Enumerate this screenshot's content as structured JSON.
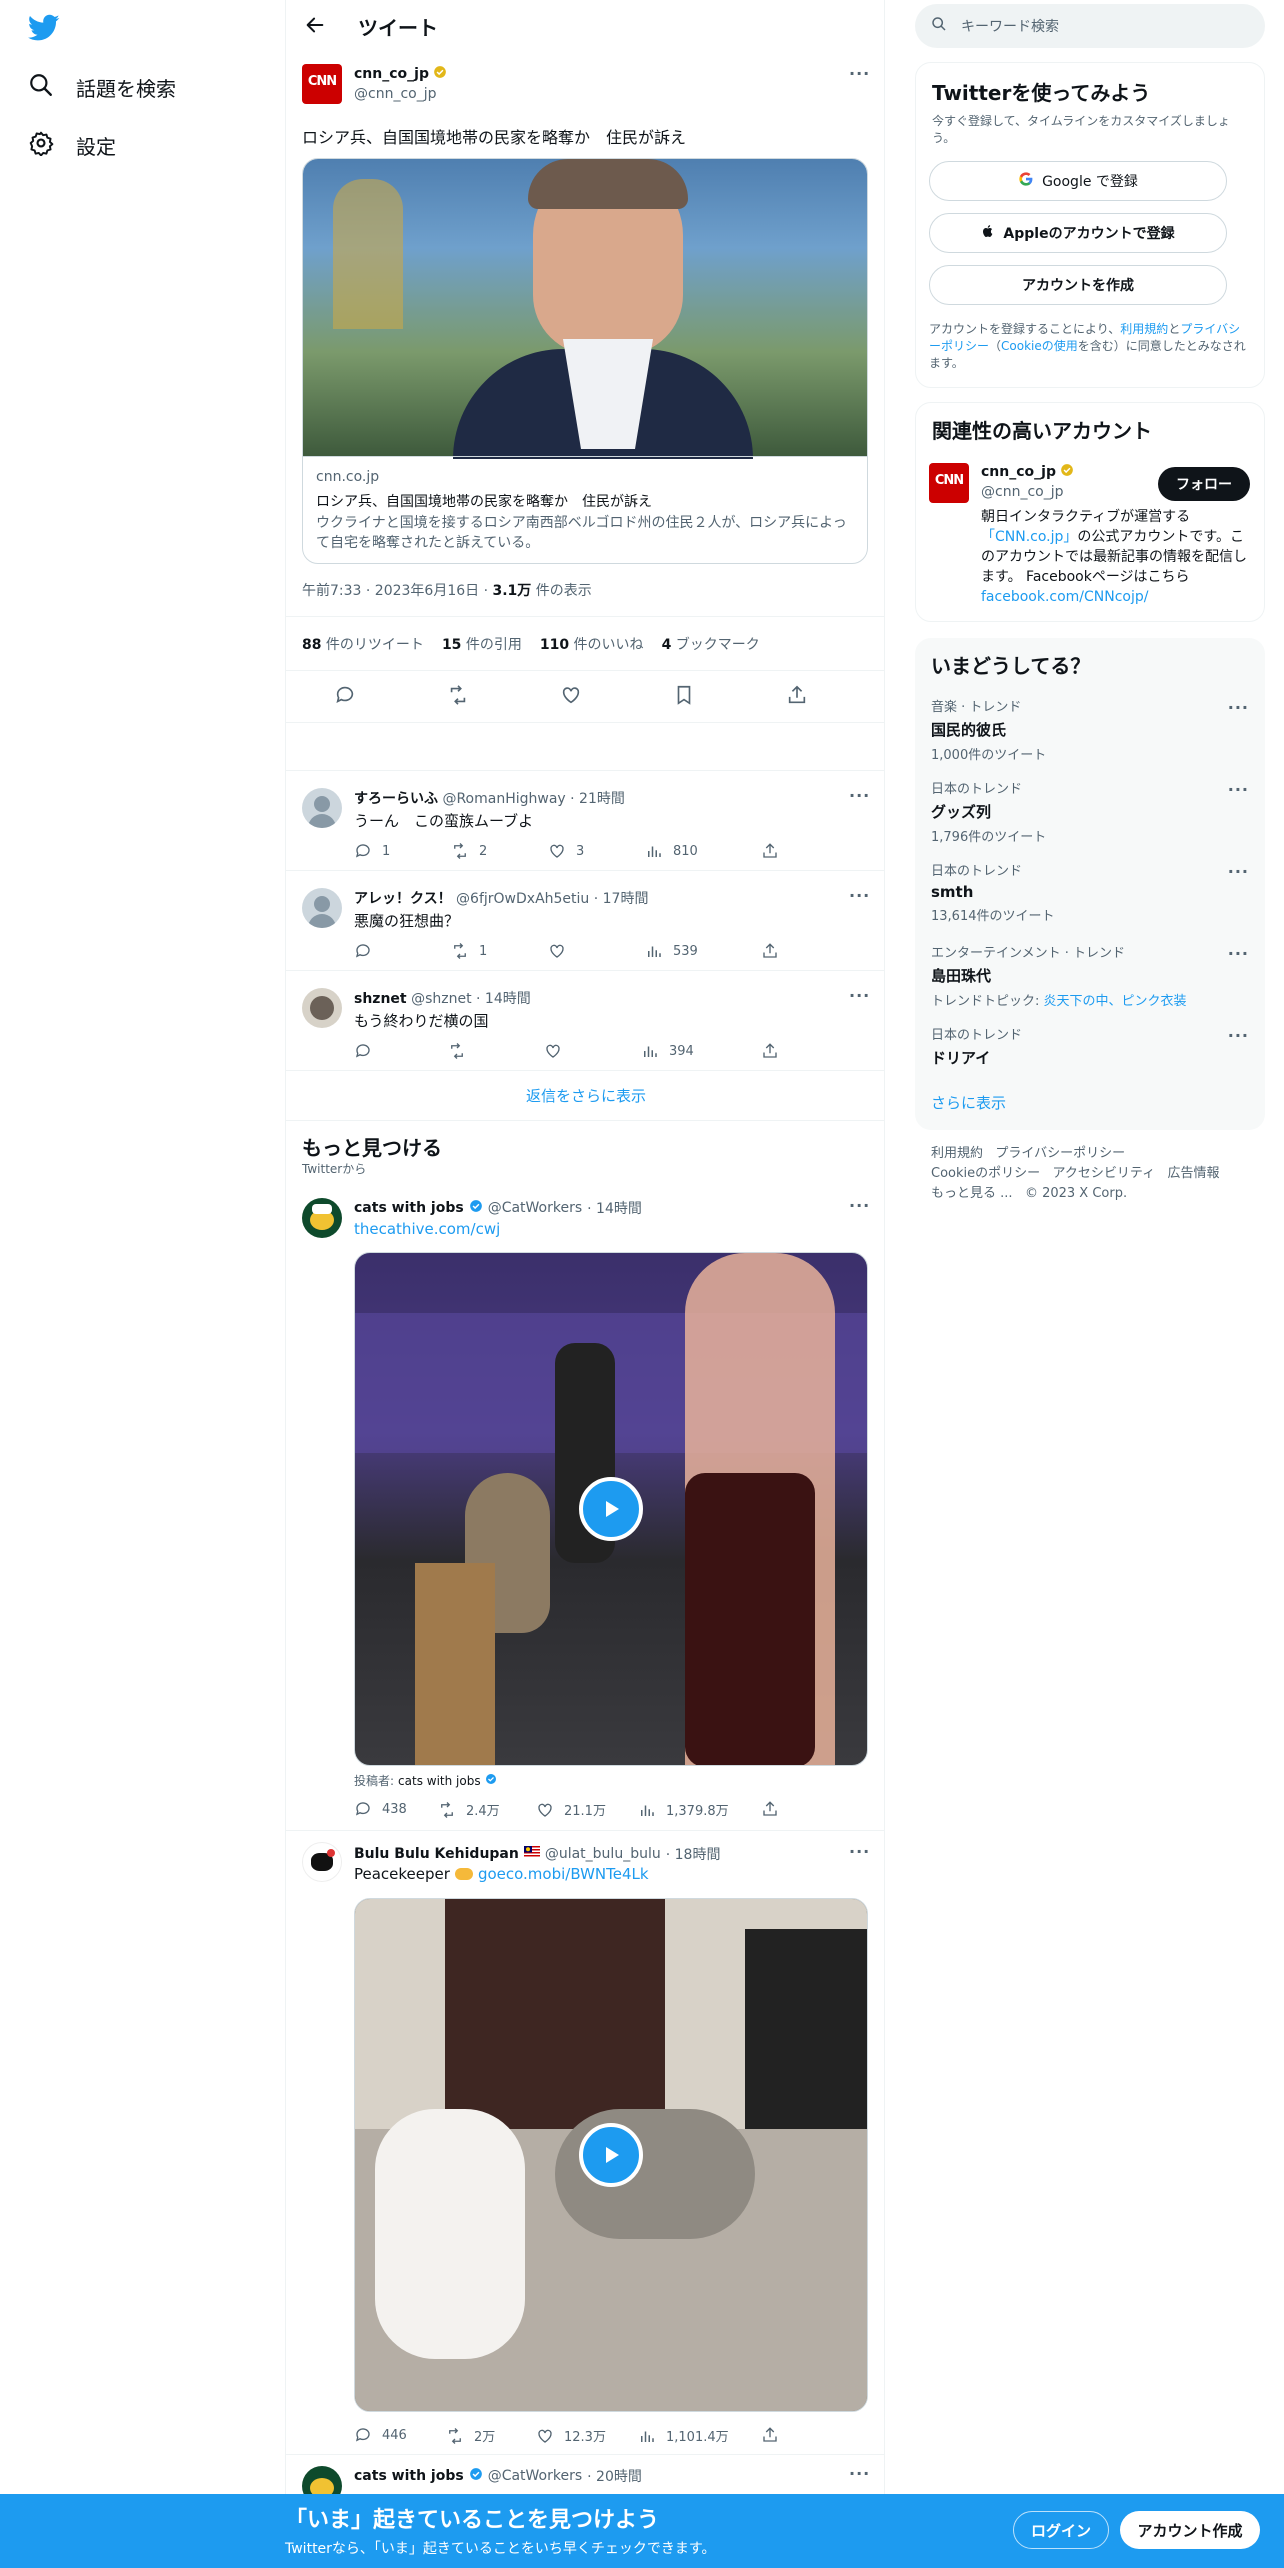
{
  "left_nav": {
    "explore_label": "話題を検索",
    "settings_label": "設定"
  },
  "header": {
    "title": "ツイート"
  },
  "tweet": {
    "display_name": "cnn_co_jp",
    "handle": "@cnn_co_jp",
    "text": "ロシア兵、自国国境地帯の民家を略奪か　住民が訴え",
    "card": {
      "domain": "cnn.co.jp",
      "title": "ロシア兵、自国国境地帯の民家を略奪か　住民が訴え",
      "description": "ウクライナと国境を接するロシア南西部ベルゴロド州の住民２人が、ロシア兵によって自宅を略奪されたと訴えている。"
    },
    "time": "午前7:33 · 2023年6月16日 · ",
    "views_count": "3.1万",
    "views_label": " 件の表示",
    "stats": {
      "retweets_count": "88",
      "retweets_label": " 件のリツイート",
      "quotes_count": "15",
      "quotes_label": " 件の引用",
      "likes_count": "110",
      "likes_label": " 件のいいね",
      "bookmarks_count": "4",
      "bookmarks_label": " ブックマーク"
    }
  },
  "replies": [
    {
      "name": "すろーらいふ",
      "handle": "@RomanHighway",
      "time": "· 21時間",
      "text": "うーん　この蛮族ムーブよ",
      "reply": "1",
      "retweet": "2",
      "like": "3",
      "views": "810"
    },
    {
      "name": "アレッ！クス！",
      "handle": "@6fjrOwDxAh5etiu",
      "time": "· 17時間",
      "text": "悪魔の狂想曲？",
      "reply": "",
      "retweet": "1",
      "like": "",
      "views": "539"
    },
    {
      "name": "shznet",
      "handle": "@shznet",
      "time": "· 14時間",
      "text": "もう終わりだ横の国",
      "reply": "",
      "retweet": "",
      "like": "",
      "views": "394"
    }
  ],
  "show_more_replies": "返信をさらに表示",
  "discover": {
    "title": "もっと見つける",
    "subtitle": "Twitterから"
  },
  "promo_tweets": [
    {
      "name": "cats with jobs",
      "handle": "@CatWorkers",
      "time": "· 14時間",
      "link": "thecathive.com/cwj",
      "credit_prefix": "投稿者: ",
      "credit_name": "cats with jobs",
      "reply": "438",
      "retweet": "2.4万",
      "like": "21.1万",
      "views": "1,379.8万"
    },
    {
      "name": "Bulu Bulu Kehidupan",
      "handle": "@ulat_bulu_bulu",
      "time": "· 18時間",
      "text": "Peacekeeper",
      "link": "goeco.mobi/BWNTe4Lk",
      "reply": "446",
      "retweet": "2万",
      "like": "12.3万",
      "views": "1,101.4万"
    },
    {
      "name": "cats with jobs",
      "handle": "@CatWorkers",
      "time": "· 20時間"
    }
  ],
  "search": {
    "placeholder": "キーワード検索"
  },
  "signup": {
    "title": "Twitterを使ってみよう",
    "subtitle": "今すぐ登録して、タイムラインをカスタマイズしましょう。",
    "google": "Google で登録",
    "apple": "Appleのアカウントで登録",
    "create": "アカウントを作成",
    "legal_1": "アカウントを登録することにより、",
    "legal_terms": "利用規約",
    "legal_2": "と",
    "legal_privacy": "プライバシーポリシー",
    "legal_3": "（",
    "legal_cookie": "Cookieの使用",
    "legal_4": "を含む）に同意したとみなされます。"
  },
  "related": {
    "title": "関連性の高いアカウント",
    "name": "cnn_co_jp",
    "handle": "@cnn_co_jp",
    "follow": "フォロー",
    "bio_1": "朝日インタラクティブが運営する",
    "bio_link": "「CNN.co.jp」",
    "bio_2": "の公式アカウントです。このアカウントでは最新記事の情報を配信します。 Facebookページはこちら ",
    "bio_fb": "facebook.com/CNNcojp/"
  },
  "trends": {
    "title": "いまどうしてる？",
    "items": [
      {
        "category": "音楽 · トレンド",
        "name": "国民的彼氏",
        "count": "1,000件のツイート"
      },
      {
        "category": "日本のトレンド",
        "name": "グッズ列",
        "count": "1,796件のツイート"
      },
      {
        "category": "日本のトレンド",
        "name": "smth",
        "count": "13,614件のツイート"
      },
      {
        "category": "エンターテインメント · トレンド",
        "name": "島田珠代",
        "count_prefix": "トレンドトピック: ",
        "count_link": "炎天下の中、ピンク衣装"
      },
      {
        "category": "日本のトレンド",
        "name": "ドリアイ"
      }
    ],
    "show_more": "さらに表示"
  },
  "footer": {
    "terms": "利用規約",
    "privacy": "プライバシーポリシー",
    "cookie": "Cookieのポリシー",
    "accessibility": "アクセシビリティ",
    "ads": "広告情報",
    "more": "もっと見る ...",
    "copyright": "© 2023 X Corp."
  },
  "bottom_bar": {
    "title": "「いま」起きていることを見つけよう",
    "subtitle": "Twitterなら、「いま」起きていることをいち早くチェックできます。",
    "login": "ログイン",
    "signup": "アカウント作成"
  },
  "colors": {
    "accent": "#1d9bf0",
    "text": "#0f1419",
    "secondary": "#536471",
    "verified_gold": "#e2b719"
  }
}
